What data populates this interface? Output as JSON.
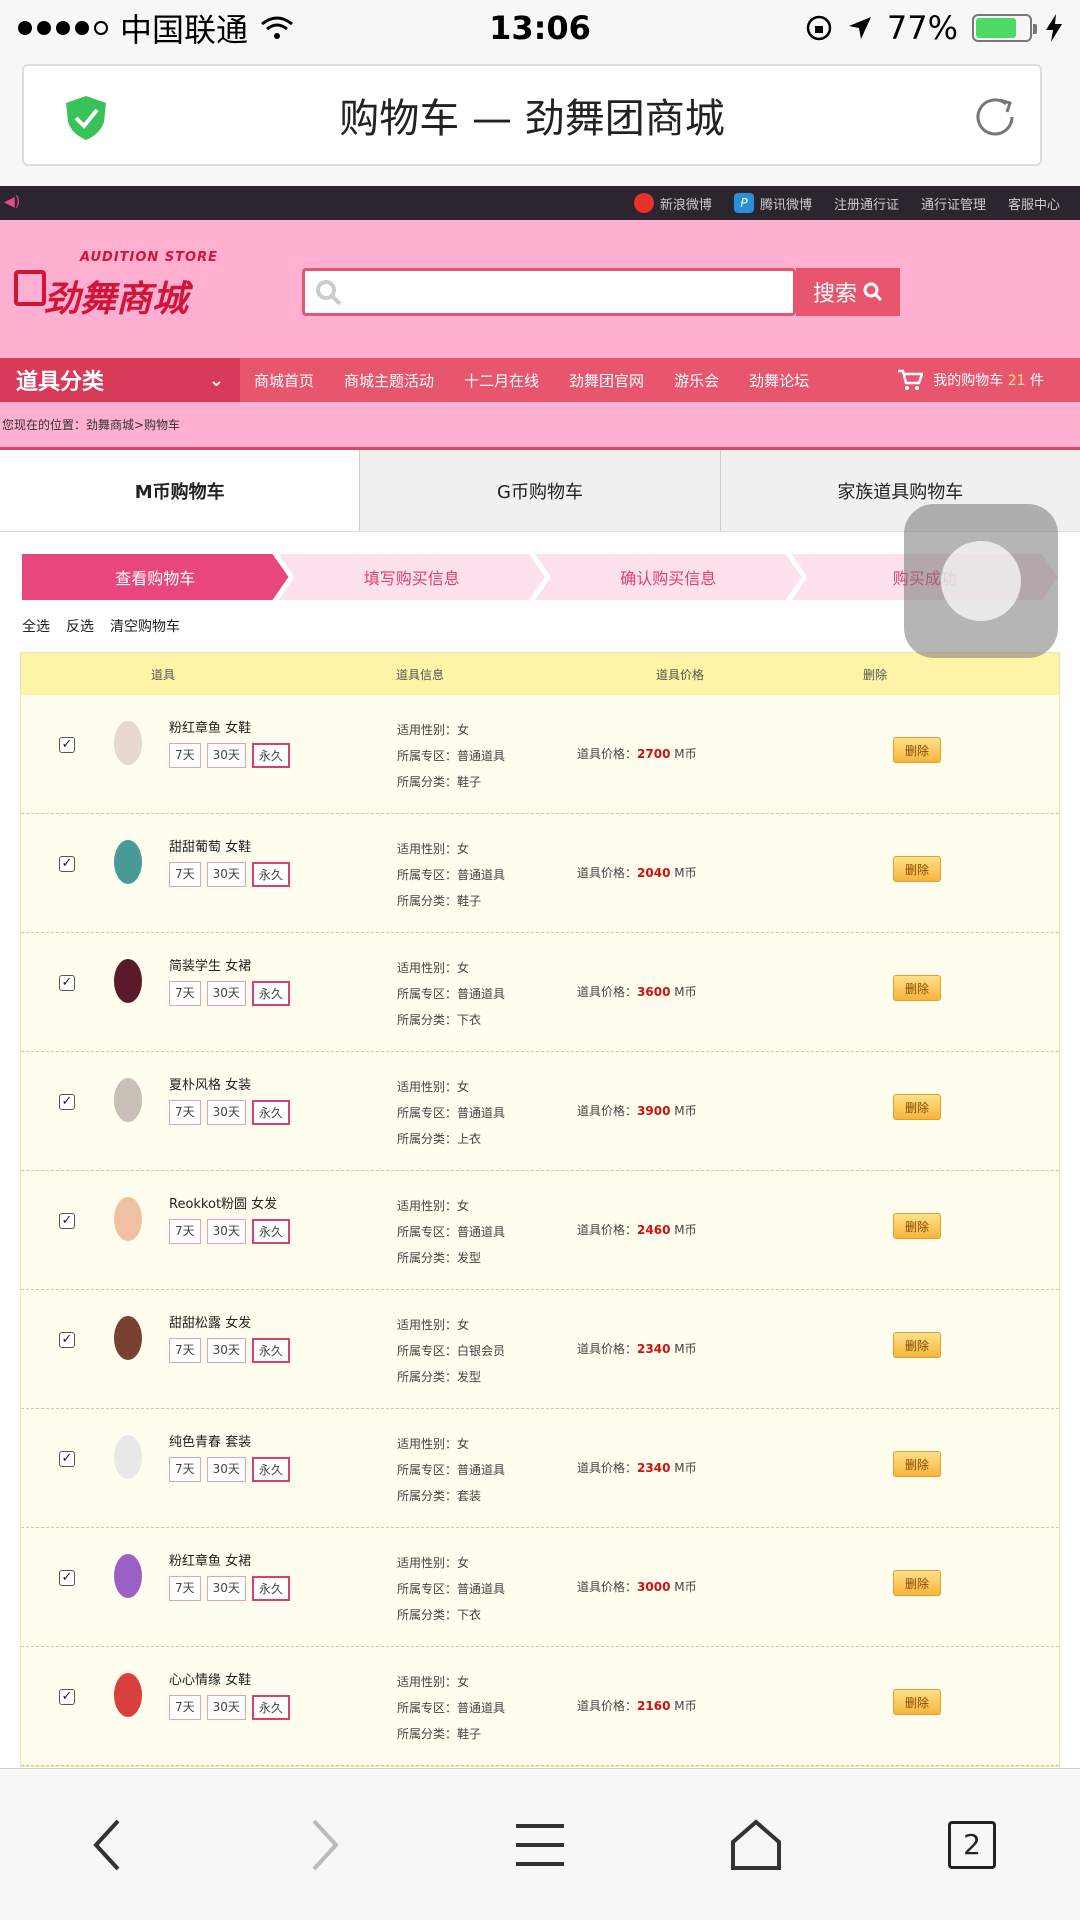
{
  "status": {
    "carrier": "中国联通",
    "time": "13:06",
    "battery": "77%",
    "battery_level": 0.77
  },
  "browser": {
    "title": "购物车 — 劲舞团商城",
    "tab_count": "2"
  },
  "site": {
    "top_links": [
      "新浪微博",
      "腾讯微博",
      "注册通行证",
      "通行证管理",
      "客服中心"
    ],
    "logo_sub": "AUDITION STORE",
    "logo_main": "劲舞商城",
    "search_button": "搜索",
    "nav_category": "道具分类",
    "nav_links": [
      "商城首页",
      "商城主题活动",
      "十二月在线",
      "劲舞团官网",
      "游乐会",
      "劲舞论坛"
    ],
    "cart_label": "我的购物车",
    "cart_count": "21",
    "cart_unit": "件",
    "breadcrumb": "您现在的位置：劲舞商城>购物车"
  },
  "tabs": [
    "M币购物车",
    "G币购物车",
    "家族道具购物车"
  ],
  "steps": [
    "查看购物车",
    "填写购买信息",
    "确认购买信息",
    "购买成功"
  ],
  "ops": [
    "全选",
    "反选",
    "清空购物车"
  ],
  "columns": [
    "道具",
    "道具信息",
    "道具价格",
    "删除"
  ],
  "labels": {
    "gender": "适用性别：",
    "zone": "所属专区：",
    "category": "所属分类：",
    "price": "道具价格：",
    "currency": "M币",
    "delete": "删除",
    "d7": "7天",
    "d30": "30天",
    "perm": "永久"
  },
  "items": [
    {
      "name": "粉红章鱼 女鞋",
      "gender": "女",
      "zone": "普通道具",
      "category": "鞋子",
      "price": "2700"
    },
    {
      "name": "甜甜葡萄 女鞋",
      "gender": "女",
      "zone": "普通道具",
      "category": "鞋子",
      "price": "2040"
    },
    {
      "name": "简装学生 女裙",
      "gender": "女",
      "zone": "普通道具",
      "category": "下衣",
      "price": "3600"
    },
    {
      "name": "夏朴风格 女装",
      "gender": "女",
      "zone": "普通道具",
      "category": "上衣",
      "price": "3900"
    },
    {
      "name": "Reokkot粉圆 女发",
      "gender": "女",
      "zone": "普通道具",
      "category": "发型",
      "price": "2460"
    },
    {
      "name": "甜甜松露 女发",
      "gender": "女",
      "zone": "白银会员",
      "category": "发型",
      "price": "2340"
    },
    {
      "name": "纯色青春 套装",
      "gender": "女",
      "zone": "普通道具",
      "category": "套装",
      "price": "2340"
    },
    {
      "name": "粉红章鱼 女裙",
      "gender": "女",
      "zone": "普通道具",
      "category": "下衣",
      "price": "3000"
    },
    {
      "name": "心心情缘 女鞋",
      "gender": "女",
      "zone": "普通道具",
      "category": "鞋子",
      "price": "2160"
    }
  ]
}
